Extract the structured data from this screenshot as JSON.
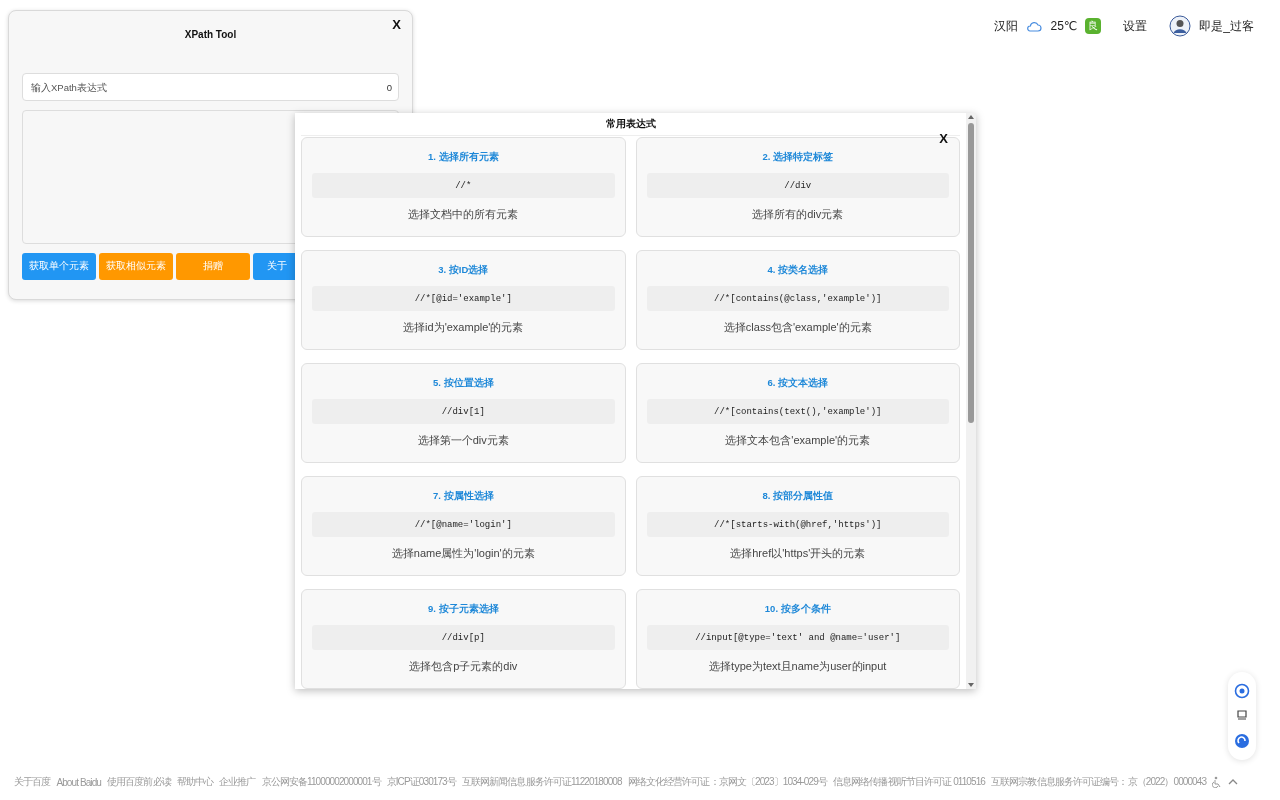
{
  "header": {
    "location": "汉阳",
    "temperature": "25℃",
    "air_quality": "良",
    "settings": "设置",
    "username": "即是_过客"
  },
  "xpath_tool": {
    "title": "XPath Tool",
    "close": "X",
    "input": {
      "placeholder": "输入XPath表达式",
      "count": "0"
    },
    "buttons": [
      {
        "label": "获取单个元素",
        "color": "#2196f3"
      },
      {
        "label": "获取相似元素",
        "color": "#ff9800"
      },
      {
        "label": "捐赠",
        "color": "#ff9800"
      },
      {
        "label": "关于",
        "color": "#2196f3"
      }
    ]
  },
  "expressions_dialog": {
    "title": "常用表达式",
    "close": "X",
    "cards": [
      {
        "title": "1. 选择所有元素",
        "expression": "//*",
        "description": "选择文档中的所有元素"
      },
      {
        "title": "2. 选择特定标签",
        "expression": "//div",
        "description": "选择所有的div元素"
      },
      {
        "title": "3. 按ID选择",
        "expression": "//*[@id='example']",
        "description": "选择id为'example'的元素"
      },
      {
        "title": "4. 按类名选择",
        "expression": "//*[contains(@class,'example')]",
        "description": "选择class包含'example'的元素"
      },
      {
        "title": "5. 按位置选择",
        "expression": "//div[1]",
        "description": "选择第一个div元素"
      },
      {
        "title": "6. 按文本选择",
        "expression": "//*[contains(text(),'example')]",
        "description": "选择文本包含'example'的元素"
      },
      {
        "title": "7. 按属性选择",
        "expression": "//*[@name='login']",
        "description": "选择name属性为'login'的元素"
      },
      {
        "title": "8. 按部分属性值",
        "expression": "//*[starts-with(@href,'https')]",
        "description": "选择href以'https'开头的元素"
      },
      {
        "title": "9. 按子元素选择",
        "expression": "//div[p]",
        "description": "选择包含p子元素的div"
      },
      {
        "title": "10. 按多个条件",
        "expression": "//input[@type='text' and @name='user']",
        "description": "选择type为text且name为user的input"
      }
    ]
  },
  "footer": {
    "links": [
      "关于百度",
      "About Baidu",
      "使用百度前必读",
      "帮助中心",
      "企业推广",
      "京公网安备11000002000001号",
      "京ICP证030173号",
      "互联网新闻信息服务许可证11220180008",
      "网络文化经营许可证：京网文〔2023〕1034-029号",
      "信息网络传播视听节目许可证 0110516",
      "互联网宗教信息服务许可证编号：京（2022）0000043"
    ]
  }
}
